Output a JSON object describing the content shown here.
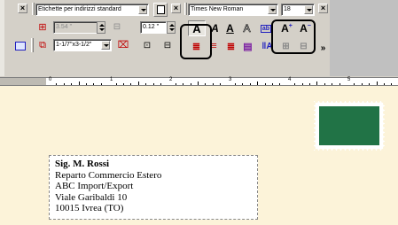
{
  "toolbar": {
    "label_style": {
      "value": "Etichette per indirizzi standard"
    },
    "width_field": {
      "value": "3.54 \""
    },
    "margin_field": {
      "value": "0.12 \""
    },
    "size_dropdown": {
      "value": "1-1/7\"x3-1/2\""
    },
    "font_name": {
      "value": "Times New Roman"
    },
    "font_size": {
      "value": "18"
    },
    "overflow_label": "»"
  },
  "ruler": {
    "numbers": [
      "0",
      "1",
      "2",
      "3",
      "4",
      "5"
    ]
  },
  "address": {
    "lines": [
      "Sig. M. Rossi",
      "Reparto Commercio Estero",
      "ABC Import/Export",
      "Viale Garibaldi 10",
      "10015 Ivrea (TO)"
    ]
  },
  "colors": {
    "stamp": "#217346",
    "background": "#fcf3d9",
    "toolbar": "#d4d0c8"
  }
}
